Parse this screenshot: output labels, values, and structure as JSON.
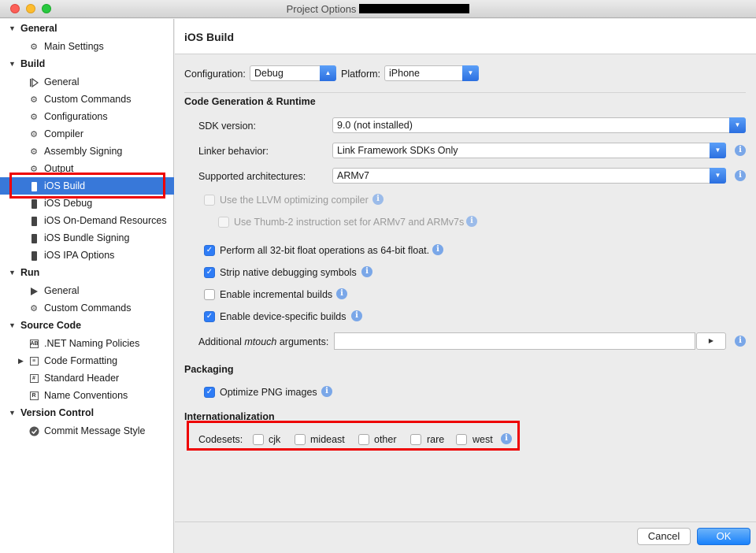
{
  "window": {
    "title": "Project Options"
  },
  "sidebar": {
    "items": [
      {
        "type": "section",
        "label": "General",
        "icon": "disclosure-down"
      },
      {
        "type": "item",
        "label": "Main Settings",
        "icon": "gear-icon"
      },
      {
        "type": "section",
        "label": "Build",
        "icon": "disclosure-down"
      },
      {
        "type": "item",
        "label": "General",
        "icon": "play-bar-icon"
      },
      {
        "type": "item",
        "label": "Custom Commands",
        "icon": "gear-icon"
      },
      {
        "type": "item",
        "label": "Configurations",
        "icon": "gear-icon"
      },
      {
        "type": "item",
        "label": "Compiler",
        "icon": "gear-icon"
      },
      {
        "type": "item",
        "label": "Assembly Signing",
        "icon": "gear-icon"
      },
      {
        "type": "item",
        "label": "Output",
        "icon": "gear-icon"
      },
      {
        "type": "item",
        "label": "iOS Build",
        "icon": "phone-icon",
        "selected": true
      },
      {
        "type": "item",
        "label": "iOS Debug",
        "icon": "phone-icon"
      },
      {
        "type": "item",
        "label": "iOS On-Demand Resources",
        "icon": "phone-icon"
      },
      {
        "type": "item",
        "label": "iOS Bundle Signing",
        "icon": "phone-icon"
      },
      {
        "type": "item",
        "label": "iOS IPA Options",
        "icon": "phone-icon"
      },
      {
        "type": "section",
        "label": "Run",
        "icon": "disclosure-down"
      },
      {
        "type": "item",
        "label": "General",
        "icon": "play-icon"
      },
      {
        "type": "item",
        "label": "Custom Commands",
        "icon": "gear-icon"
      },
      {
        "type": "section",
        "label": "Source Code",
        "icon": "disclosure-down"
      },
      {
        "type": "item",
        "label": ".NET Naming Policies",
        "icon": "naming-policies-icon"
      },
      {
        "type": "item",
        "label": "Code Formatting",
        "icon": "code-format-icon",
        "expandable": true
      },
      {
        "type": "item",
        "label": "Standard Header",
        "icon": "header-icon"
      },
      {
        "type": "item",
        "label": "Name Conventions",
        "icon": "name-conventions-icon"
      },
      {
        "type": "section",
        "label": "Version Control",
        "icon": "disclosure-down"
      },
      {
        "type": "item",
        "label": "Commit Message Style",
        "icon": "commit-icon"
      }
    ]
  },
  "panel": {
    "title": "iOS Build",
    "configuration": {
      "label": "Configuration:",
      "value": "Debug"
    },
    "platform": {
      "label": "Platform:",
      "value": "iPhone"
    },
    "codegen": {
      "heading": "Code Generation & Runtime",
      "sdk": {
        "label": "SDK version:",
        "value": "9.0 (not installed)"
      },
      "linker": {
        "label": "Linker behavior:",
        "value": "Link Framework SDKs Only"
      },
      "arch": {
        "label": "Supported architectures:",
        "value": "ARMv7"
      },
      "llvm": {
        "label": "Use the LLVM optimizing compiler",
        "checked": false,
        "enabled": false
      },
      "thumb": {
        "label": "Use Thumb-2 instruction set for ARMv7 and ARMv7s",
        "checked": false,
        "enabled": false
      },
      "float32": {
        "label": "Perform all 32-bit float operations as 64-bit float.",
        "checked": true
      },
      "strip": {
        "label": "Strip native debugging symbols",
        "checked": true
      },
      "incremental": {
        "label": "Enable incremental builds",
        "checked": false
      },
      "device_specific": {
        "label": "Enable device-specific builds",
        "checked": true
      },
      "mtouch": {
        "label_prefix": "Additional ",
        "label_em": "mtouch",
        "label_suffix": " arguments:",
        "value": ""
      }
    },
    "packaging": {
      "heading": "Packaging",
      "optimize_png": {
        "label": "Optimize PNG images",
        "checked": true
      }
    },
    "i18n": {
      "heading": "Internationalization",
      "codesets_label": "Codesets:",
      "codesets": [
        {
          "label": "cjk",
          "checked": false
        },
        {
          "label": "mideast",
          "checked": false
        },
        {
          "label": "other",
          "checked": false
        },
        {
          "label": "rare",
          "checked": false
        },
        {
          "label": "west",
          "checked": false
        }
      ]
    }
  },
  "footer": {
    "cancel": "Cancel",
    "ok": "OK"
  },
  "colors": {
    "selection": "#3878d9",
    "accent": "#2e7cf6",
    "highlight": "#ee0000"
  }
}
